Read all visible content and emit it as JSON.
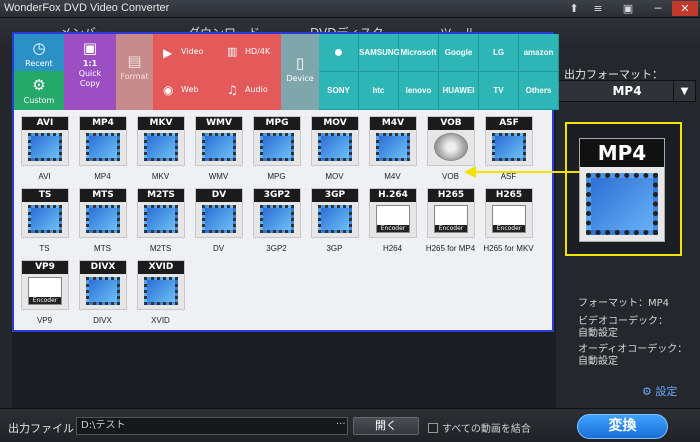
{
  "window": {
    "title": "WonderFox DVD Video Converter",
    "buttons": [
      "⬆",
      "≡",
      "▣",
      "─",
      "✕"
    ]
  },
  "bg_toolbar": {
    "tabs": [
      "メンバー",
      "ダウンロード",
      "DVDディスク",
      "ツール"
    ]
  },
  "categories": {
    "recent": "Recent",
    "custom": "Custom",
    "quick_title": "1:1",
    "quick_sub": "Quick",
    "quick_sub2": "Copy",
    "format": "Format",
    "video": "Video",
    "web": "Web",
    "hd": "HD/4K",
    "audio": "Audio",
    "device": "Device"
  },
  "brands_row1": [
    "",
    "SAMSUNG",
    "Microsoft",
    "Google",
    "LG",
    "amazon"
  ],
  "brands_row2": [
    "SONY",
    "htc",
    "lenovo",
    "HUAWEI",
    "TV",
    "Others"
  ],
  "formats": [
    {
      "label": "AVI",
      "name": "AVI"
    },
    {
      "label": "MP4",
      "name": "MP4"
    },
    {
      "label": "MKV",
      "name": "MKV"
    },
    {
      "label": "WMV",
      "name": "WMV"
    },
    {
      "label": "MPG",
      "name": "MPG"
    },
    {
      "label": "MOV",
      "name": "MOV"
    },
    {
      "label": "M4V",
      "name": "M4V"
    },
    {
      "label": "VOB",
      "name": "VOB"
    },
    {
      "label": "ASF",
      "name": "ASF"
    },
    {
      "label": "TS",
      "name": "TS"
    },
    {
      "label": "MTS",
      "name": "MTS"
    },
    {
      "label": "M2TS",
      "name": "M2TS"
    },
    {
      "label": "DV",
      "name": "DV"
    },
    {
      "label": "3GP2",
      "name": "3GP2"
    },
    {
      "label": "3GP",
      "name": "3GP"
    },
    {
      "label": "H.264",
      "name": "H264"
    },
    {
      "label": "H265",
      "name": "H265 for MP4"
    },
    {
      "label": "H265",
      "name": "H265 for MKV"
    },
    {
      "label": "VP9",
      "name": "VP9"
    },
    {
      "label": "DIVX",
      "name": "DIVX"
    },
    {
      "label": "XVID",
      "name": "XVID"
    }
  ],
  "right_panel": {
    "output_format_label": "出力フォーマット：",
    "selected_format": "MP4",
    "preview_label": "MP4",
    "format_info": "フォーマット：MP4",
    "video_codec_label": "ビデオコーデック：",
    "video_codec_value": "自動設定",
    "audio_codec_label": "オーディオコーデック：",
    "audio_codec_value": "自動設定",
    "settings_link": "設定"
  },
  "bottom_bar": {
    "output_file_label": "出力ファイル：",
    "output_path": "D:\\テスト",
    "browse": "···",
    "open_button": "開く",
    "merge_label": "すべての動画を結合",
    "convert_button": "変換"
  },
  "colors": {
    "accent": "#2b3bd9",
    "highlight": "#f2e200",
    "convert": "#2a86ea"
  }
}
